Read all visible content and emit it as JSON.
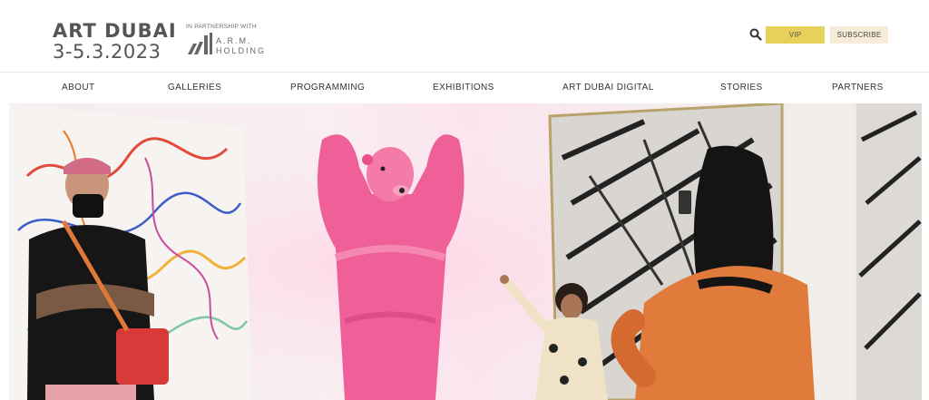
{
  "brand": {
    "title": "ART DUBAI",
    "dates": "3-5.3.2023",
    "partner_caption": "IN PARTNERSHIP WITH",
    "partner_name_line1": "A.R.M.",
    "partner_name_line2": "HOLDING"
  },
  "header_actions": {
    "search_icon": "search-icon",
    "vip_label": "VIP",
    "subscribe_label": "SUBSCRIBE"
  },
  "nav": {
    "items": [
      {
        "label": "ABOUT"
      },
      {
        "label": "GALLERIES"
      },
      {
        "label": "PROGRAMMING"
      },
      {
        "label": "EXHIBITIONS"
      },
      {
        "label": "ART DUBAI DIGITAL"
      },
      {
        "label": "STORIES"
      },
      {
        "label": "PARTNERS"
      }
    ]
  },
  "colors": {
    "vip_bg": "#e7d15a",
    "subscribe_bg": "#f7ecd8",
    "text_dark": "#333333",
    "logo_grey": "#555555",
    "costume_pink": "#f0609a"
  }
}
